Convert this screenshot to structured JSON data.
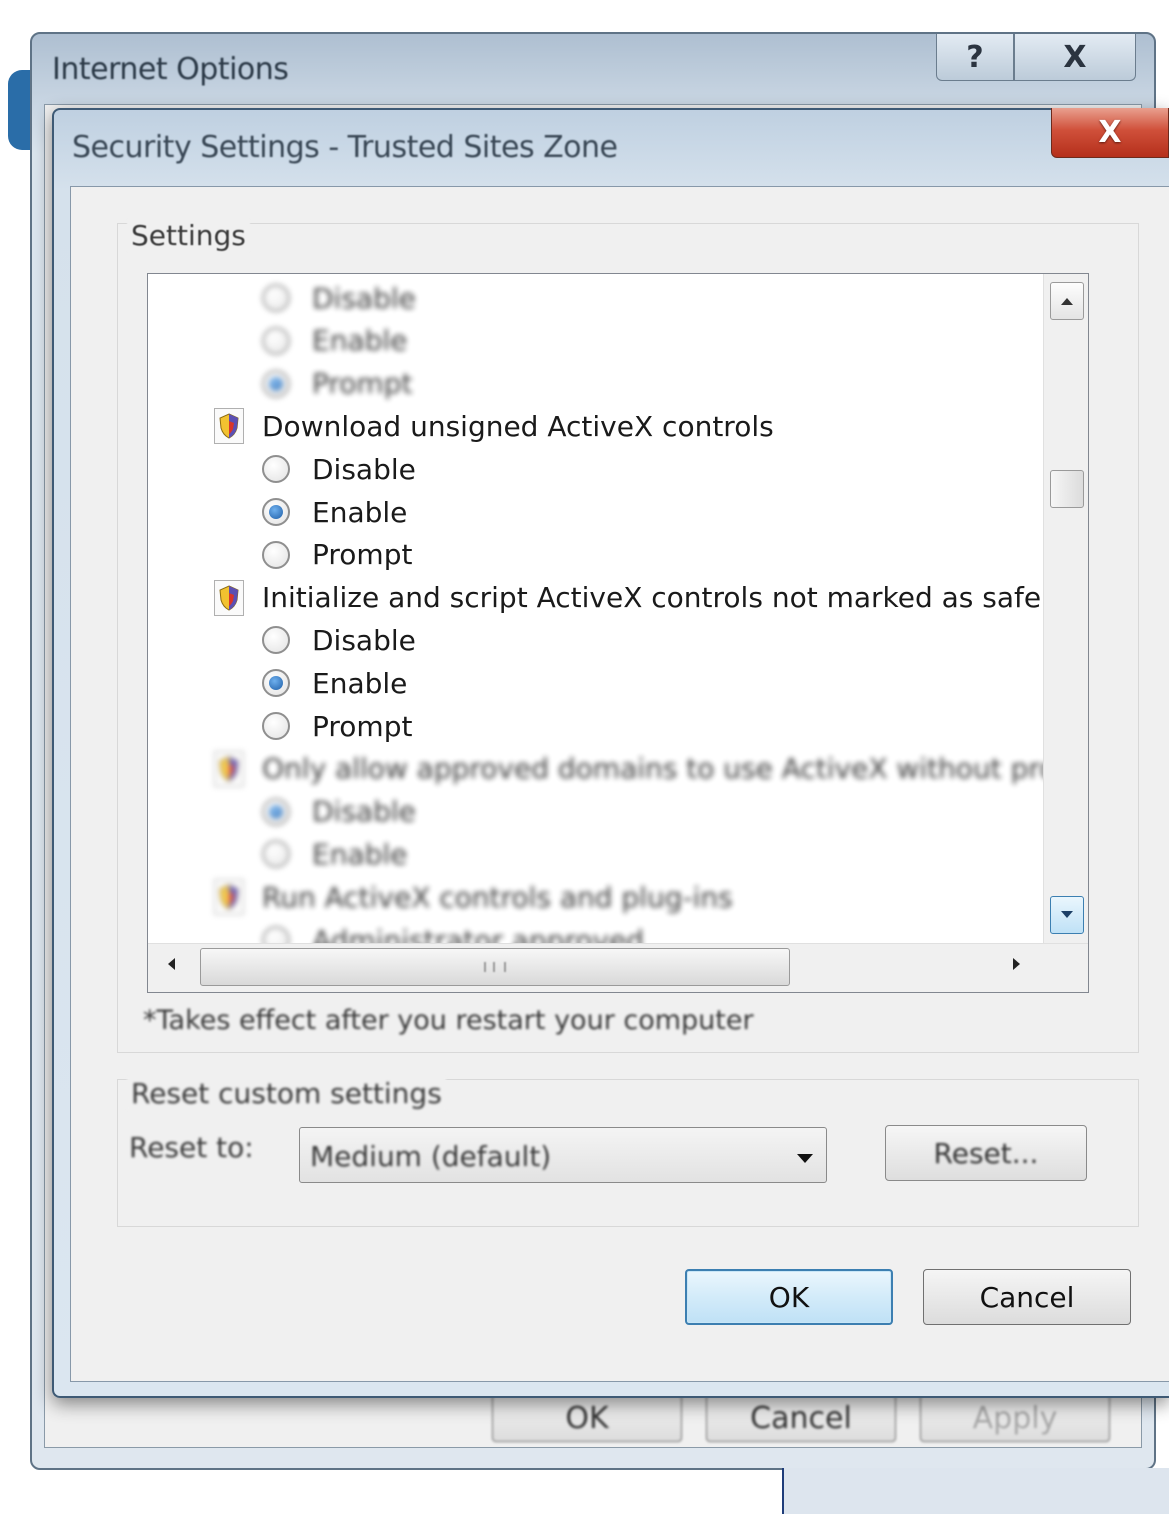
{
  "background_window": {
    "title": "Internet Options",
    "help_glyph": "?",
    "close_glyph": "X",
    "buttons": [
      "OK",
      "Cancel",
      "Apply"
    ]
  },
  "dialog": {
    "title": "Security Settings - Trusted Sites Zone",
    "close_glyph": "X",
    "settings_label": "Settings",
    "tree": [
      {
        "type": "option",
        "label": "Disable",
        "checked": false,
        "blurred": true
      },
      {
        "type": "option",
        "label": "Enable",
        "checked": false,
        "blurred": true
      },
      {
        "type": "option",
        "label": "Prompt",
        "checked": true,
        "blurred": true
      },
      {
        "type": "setting",
        "label": "Download unsigned ActiveX controls",
        "icon": "shield-icon",
        "blurred": false
      },
      {
        "type": "option",
        "label": "Disable",
        "checked": false,
        "blurred": false
      },
      {
        "type": "option",
        "label": "Enable",
        "checked": true,
        "blurred": false
      },
      {
        "type": "option",
        "label": "Prompt",
        "checked": false,
        "blurred": false
      },
      {
        "type": "setting",
        "label": "Initialize and script ActiveX controls not marked as safe for scripting",
        "icon": "shield-icon",
        "blurred": false
      },
      {
        "type": "option",
        "label": "Disable",
        "checked": false,
        "blurred": false
      },
      {
        "type": "option",
        "label": "Enable",
        "checked": true,
        "blurred": false
      },
      {
        "type": "option",
        "label": "Prompt",
        "checked": false,
        "blurred": false
      },
      {
        "type": "setting",
        "label": "Only allow approved domains to use ActiveX without prompt",
        "icon": "shield-icon",
        "blurred": true
      },
      {
        "type": "option",
        "label": "Disable",
        "checked": true,
        "blurred": true
      },
      {
        "type": "option",
        "label": "Enable",
        "checked": false,
        "blurred": true
      },
      {
        "type": "setting",
        "label": "Run ActiveX controls and plug-ins",
        "icon": "shield-icon",
        "blurred": true
      },
      {
        "type": "option",
        "label": "Administrator approved",
        "checked": false,
        "blurred": true
      }
    ],
    "note": "*Takes effect after you restart your computer",
    "reset_group_label": "Reset custom settings",
    "reset_to_label": "Reset to:",
    "reset_select_value": "Medium (default)",
    "reset_button": "Reset...",
    "ok_button": "OK",
    "cancel_button": "Cancel"
  }
}
